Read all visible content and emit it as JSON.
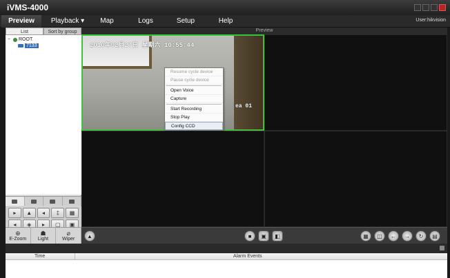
{
  "app": {
    "title": "iVMS-4000",
    "user": "User:hikvision"
  },
  "menu": [
    {
      "label": "Preview"
    },
    {
      "label": "Playback ▾"
    },
    {
      "label": "Map"
    },
    {
      "label": "Logs"
    },
    {
      "label": "Setup"
    },
    {
      "label": "Help"
    }
  ],
  "left_panel": {
    "tabs": [
      {
        "label": "List"
      },
      {
        "label": "Sort by group"
      }
    ],
    "tree": {
      "root": "ROOT",
      "root_toggle": "−",
      "camera": "7133"
    }
  },
  "ptz": {
    "buttons": [
      "▸",
      "▲",
      "◂",
      "‡",
      "▦",
      "◂",
      "◈",
      "▸",
      "▢",
      "▣",
      "▸",
      "▼",
      "◂",
      "○",
      "◌"
    ]
  },
  "bottom_tools": [
    {
      "icon": "⊕",
      "label": "E-Zoom"
    },
    {
      "icon": "☗",
      "label": "Light"
    },
    {
      "icon": "⌀",
      "label": "Wiper"
    }
  ],
  "preview": {
    "header": "Preview",
    "osd_date": "2010年02月27日 星期六 10:55:44",
    "osd_cam": "ea 01"
  },
  "context_menu": [
    {
      "label": "Resume cycle device",
      "disabled": true
    },
    {
      "label": "Pause cycle device",
      "disabled": true
    },
    {
      "label": "Open Voice"
    },
    {
      "label": "Capture"
    },
    {
      "label": "Start Recording"
    },
    {
      "label": "Stop Play"
    },
    {
      "label": "Config CCD Parameters..."
    }
  ],
  "alarm": {
    "col_time": "Time",
    "col_events": "Alarm Events"
  },
  "colors": {
    "active_border": "#3fc13f",
    "background": "#1a1a1a"
  }
}
